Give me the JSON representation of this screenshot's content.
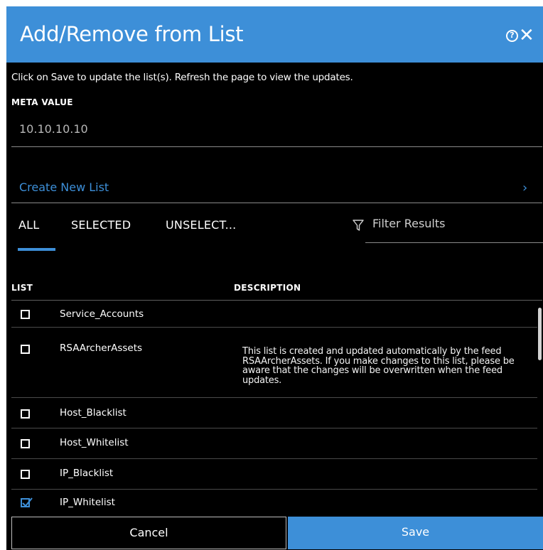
{
  "dialog": {
    "title": "Add/Remove from List",
    "help_icon": "?",
    "close_icon": "✕",
    "instructions": "Click on Save to update the list(s). Refresh the page to view the updates.",
    "meta_label": "META VALUE",
    "meta_value": "10.10.10.10",
    "create_new_list": "Create New List",
    "chevron": "›"
  },
  "tabs": [
    {
      "label": "ALL",
      "active": true
    },
    {
      "label": "SELECTED",
      "active": false
    },
    {
      "label": "UNSELECT...",
      "active": false
    }
  ],
  "filter": {
    "placeholder": "Filter Results",
    "icon": "filter-icon"
  },
  "table": {
    "columns": [
      "LIST",
      "DESCRIPTION"
    ],
    "rows": [
      {
        "name": "Service_Accounts",
        "description": "",
        "checked": false
      },
      {
        "name": "RSAArcherAssets",
        "description": "This list is created and updated automatically by the feed RSAArcherAssets. If you make changes to this list, please be aware that the changes will be overwritten when the feed updates.",
        "checked": false
      },
      {
        "name": "Host_Blacklist",
        "description": "",
        "checked": false
      },
      {
        "name": "Host_Whitelist",
        "description": "",
        "checked": false
      },
      {
        "name": "IP_Blacklist",
        "description": "",
        "checked": false
      },
      {
        "name": "IP_Whitelist",
        "description": "",
        "checked": true
      }
    ]
  },
  "footer": {
    "cancel_label": "Cancel",
    "save_label": "Save"
  },
  "colors": {
    "accent": "#3d8fd8",
    "background": "#000000"
  }
}
